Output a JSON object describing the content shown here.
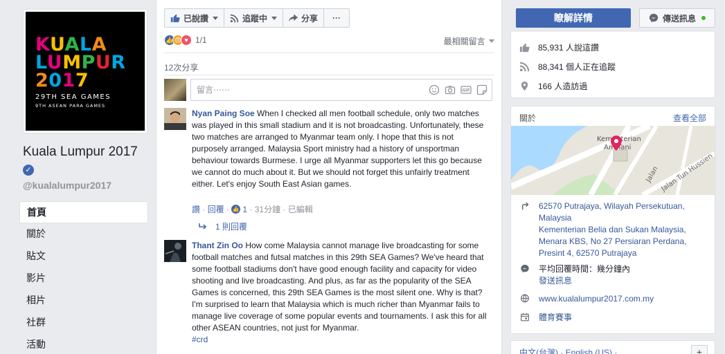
{
  "page": {
    "logo": {
      "line1": [
        "K",
        "U",
        "A",
        "L",
        "A"
      ],
      "line2": [
        "L",
        "U",
        "M",
        "P",
        "U",
        "R"
      ],
      "line3": [
        "2",
        "0",
        "1",
        "7"
      ],
      "sub1": "29TH SEA GAMES",
      "sub2": "9TH ASEAN PARA GAMES"
    },
    "name": "Kuala Lumpur 2017",
    "handle": "@kualalumpur2017",
    "nav": [
      "首頁",
      "關於",
      "貼文",
      "影片",
      "相片",
      "社群",
      "活動"
    ]
  },
  "toolbar": {
    "like": "已說讚",
    "follow": "追蹤中",
    "share": "分享",
    "more": "···"
  },
  "post": {
    "reaction_count": "1/1",
    "sort": "最相關留言",
    "shares": "12次分享",
    "comment_placeholder": "留言⋯⋯"
  },
  "comments": [
    {
      "name": "Nyan Paing Soe",
      "text": "When I checked all men football schedule, only two matches was played in this small stadium and it is not broadcasting. Unfortunately, these two matches are arranged to Myanmar team only. I hope that this is not purposely arranged. Malaysia Sport ministry had a history of unsportman behaviour towards Burmese. I urge all Myanmar supporters let this go because we cannot do much about it. But we should not forget this unfairly treatment either. Let's enjoy South East Asian games.",
      "like": "讚",
      "reply": "回覆",
      "likes": "1",
      "time": "31分鐘",
      "edited": "已編輯",
      "replies": "1 則回覆"
    },
    {
      "name": "Thant Zin Oo",
      "text": "How come Malaysia cannot manage live broadcasting for some football matches and futsal matches in this 29th SEA Games? We've heard that some football stadiums don't have good enough facility and capacity for video shooting and live broadcasting. And plus, as far as the popularity of the SEA Games is concerned, this 29th SEA Games is the most silent one. Why is that? I'm surprised to learn that Malaysia which is much richer than Myanmar fails to manage live coverage of some popular events and tournaments. I ask this for all other ASEAN countries, not just for Myanmar.",
      "hashtag": "#crd"
    }
  ],
  "sidebar": {
    "learn_more": "瞭解詳情",
    "send_message": "傳送訊息",
    "likes": "85,931 人說這讚",
    "followers": "88,341 個人正在追蹤",
    "checkins": "166 人造訪過",
    "about": "關於",
    "see_all": "查看全部",
    "map_labels": [
      "Kementerian",
      "Am Tani",
      "Jalan",
      "Jalan Tun Hussien"
    ],
    "address": [
      "62570 Putrajaya, Wilayah Persekutuan,",
      "Malaysia"
    ],
    "address_detail": "Kementerian Belia dan Sukan Malaysia, Menara KBS, No 27 Persiaran Perdana, Presint 4, 62570 Putrajaya",
    "response_time": "平均回覆時間：幾分鐘內",
    "send_msg_link": "發送訊息",
    "website": "www.kualalumpur2017.com.my",
    "category": "體育賽事",
    "languages": "中文(台灣) · English (US) ·",
    "add": "+"
  }
}
